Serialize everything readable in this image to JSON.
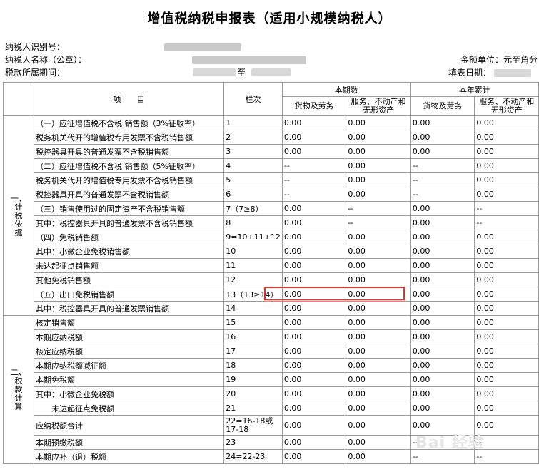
{
  "title": "增值税纳税申报表（适用小规模纳税人）",
  "header": {
    "taxpayer_id_label": "纳税人识别号：",
    "taxpayer_name_label": "纳税人名称（公章）：",
    "period_label": "税款所属期间：",
    "period_to": "至",
    "unit_label": "金额单位：元至角分",
    "fill_date_label": "填表日期："
  },
  "columns": {
    "item": "项　　目",
    "line": "栏次",
    "current_period": "本期数",
    "ytd": "本年累计",
    "goods": "货物及劳务",
    "services": "服务、不动产和无形资产"
  },
  "groups": {
    "g1": [
      "一、",
      "计",
      "税",
      "依",
      "据"
    ],
    "g2": [
      "二、",
      "税",
      "款",
      "计",
      "算"
    ]
  },
  "rows": [
    {
      "item": "（一）应征增值税不含税 销售额（3%征收率）",
      "line": "1",
      "v": [
        "0.00",
        "0.00",
        "0.00",
        "0.00"
      ]
    },
    {
      "item": "税务机关代开的增值税专用发票不含税销售额",
      "line": "2",
      "v": [
        "0.00",
        "0.00",
        "0.00",
        "0.00"
      ]
    },
    {
      "item": "税控器具开具的普通发票不含税销售额",
      "line": "3",
      "v": [
        "0.00",
        "0.00",
        "0.00",
        "0.00"
      ]
    },
    {
      "item": "（二）应征增值税不含税 销售额（5%征收率）",
      "line": "4",
      "v": [
        "--",
        "0.00",
        "--",
        "0.00"
      ]
    },
    {
      "item": "税务机关代开的增值税专用发票不含税销售额",
      "line": "5",
      "v": [
        "--",
        "0.00",
        "--",
        "0.00"
      ]
    },
    {
      "item": "税控器具开具的普通发票不含税销售额",
      "line": "6",
      "v": [
        "--",
        "0.00",
        "--",
        "0.00"
      ]
    },
    {
      "item": "（三）销售使用过的固定资产不含税销售额",
      "line": "7（7≥8）",
      "v": [
        "0.00",
        "--",
        "0.00",
        "--"
      ]
    },
    {
      "item": "其中：税控器具开具的普通发票不含税销售额",
      "line": "8",
      "v": [
        "0.00",
        "--",
        "0.00",
        "--"
      ]
    },
    {
      "item": "（四）免税销售额",
      "line": "9=10+11+12",
      "v": [
        "0.00",
        "0.00",
        "0.00",
        "0.00"
      ]
    },
    {
      "item": "其中：小微企业免税销售额",
      "line": "10",
      "v": [
        "0.00",
        "0.00",
        "0.00",
        "0.00"
      ]
    },
    {
      "item": "未达起征点销售额",
      "line": "11",
      "v": [
        "0.00",
        "0.00",
        "0.00",
        "0.00"
      ]
    },
    {
      "item": "其他免税销售额",
      "line": "12",
      "v": [
        "0.00",
        "0.00",
        "0.00",
        "0.00"
      ]
    },
    {
      "item": "（五）出口免税销售额",
      "line": "13（13≥14）",
      "v": [
        "0.00",
        "0.00",
        "0.00",
        "0.00"
      ]
    },
    {
      "item": "其中：税控器具开具的普通发票销售额",
      "line": "14",
      "v": [
        "0.00",
        "0.00",
        "0.00",
        "0.00"
      ]
    },
    {
      "item": "核定销售额",
      "line": "15",
      "v": [
        "0.00",
        "0.00",
        "0.00",
        "0.00"
      ]
    },
    {
      "item": "本期应纳税额",
      "line": "16",
      "v": [
        "0.00",
        "0.00",
        "0.00",
        "0.00"
      ]
    },
    {
      "item": "核定应纳税额",
      "line": "17",
      "v": [
        "0.00",
        "0.00",
        "0.00",
        "0.00"
      ]
    },
    {
      "item": "本期应纳税额减征额",
      "line": "18",
      "v": [
        "0.00",
        "0.00",
        "0.00",
        "0.00"
      ]
    },
    {
      "item": "本期免税额",
      "line": "19",
      "v": [
        "0.00",
        "0.00",
        "0.00",
        "0.00"
      ]
    },
    {
      "item": "其中：小微企业免税额",
      "line": "20",
      "v": [
        "0.00",
        "0.00",
        "0.00",
        "0.00"
      ]
    },
    {
      "item": "　　未达起征点免税额",
      "line": "21",
      "v": [
        "0.00",
        "0.00",
        "0.00",
        "0.00"
      ]
    },
    {
      "item": "应纳税额合计",
      "line": "22=16-18或17-18",
      "v": [
        "0.00",
        "0.00",
        "0.00",
        "0.00"
      ]
    },
    {
      "item": "本期预缴税额",
      "line": "23",
      "v": [
        "0.00",
        "0.00",
        "--",
        "--"
      ]
    },
    {
      "item": "本期应补（退）税额",
      "line": "24=22-23",
      "v": [
        "0.00",
        "0.00",
        "--",
        "--"
      ]
    }
  ],
  "watermark": "Bai 经验",
  "colors": {
    "highlight": "#e0302a",
    "grid": "#9a9a9a"
  }
}
